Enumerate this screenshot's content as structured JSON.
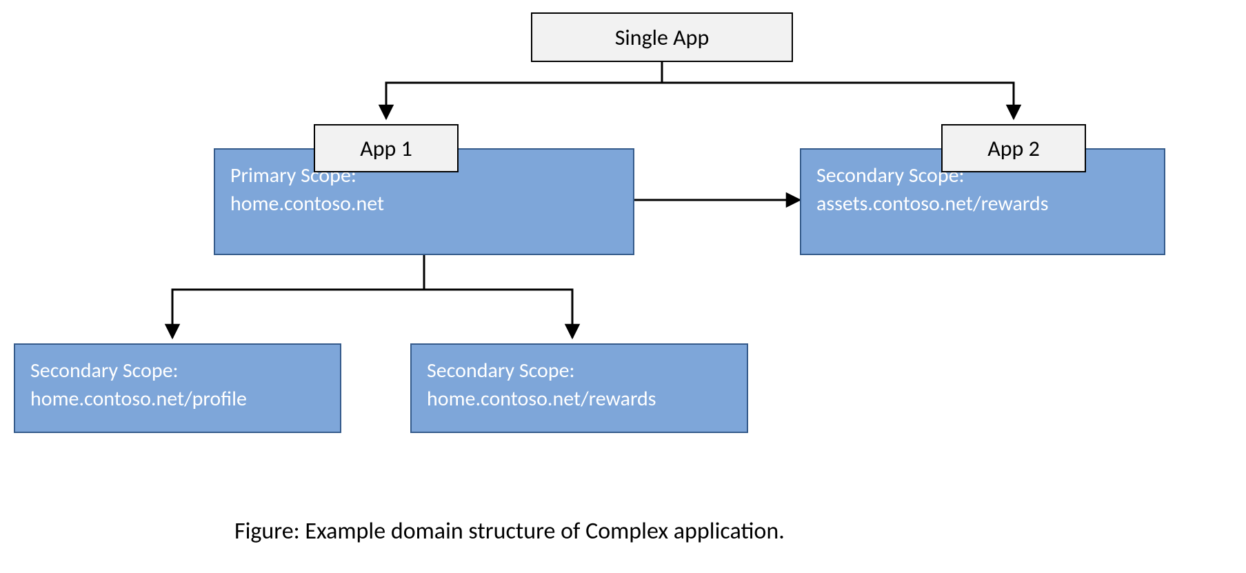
{
  "root": {
    "label": "Single App"
  },
  "app1": {
    "label": "App 1",
    "scope_title": "Primary Scope:",
    "scope_value": "home.contoso.net"
  },
  "app2": {
    "label": "App 2",
    "scope_title": "Secondary Scope:",
    "scope_value": "assets.contoso.net/rewards"
  },
  "child_left": {
    "scope_title": "Secondary Scope:",
    "scope_value": "home.contoso.net/profile"
  },
  "child_right": {
    "scope_title": "Secondary Scope:",
    "scope_value": "home.contoso.net/rewards"
  },
  "caption": "Figure: Example domain structure of Complex application."
}
